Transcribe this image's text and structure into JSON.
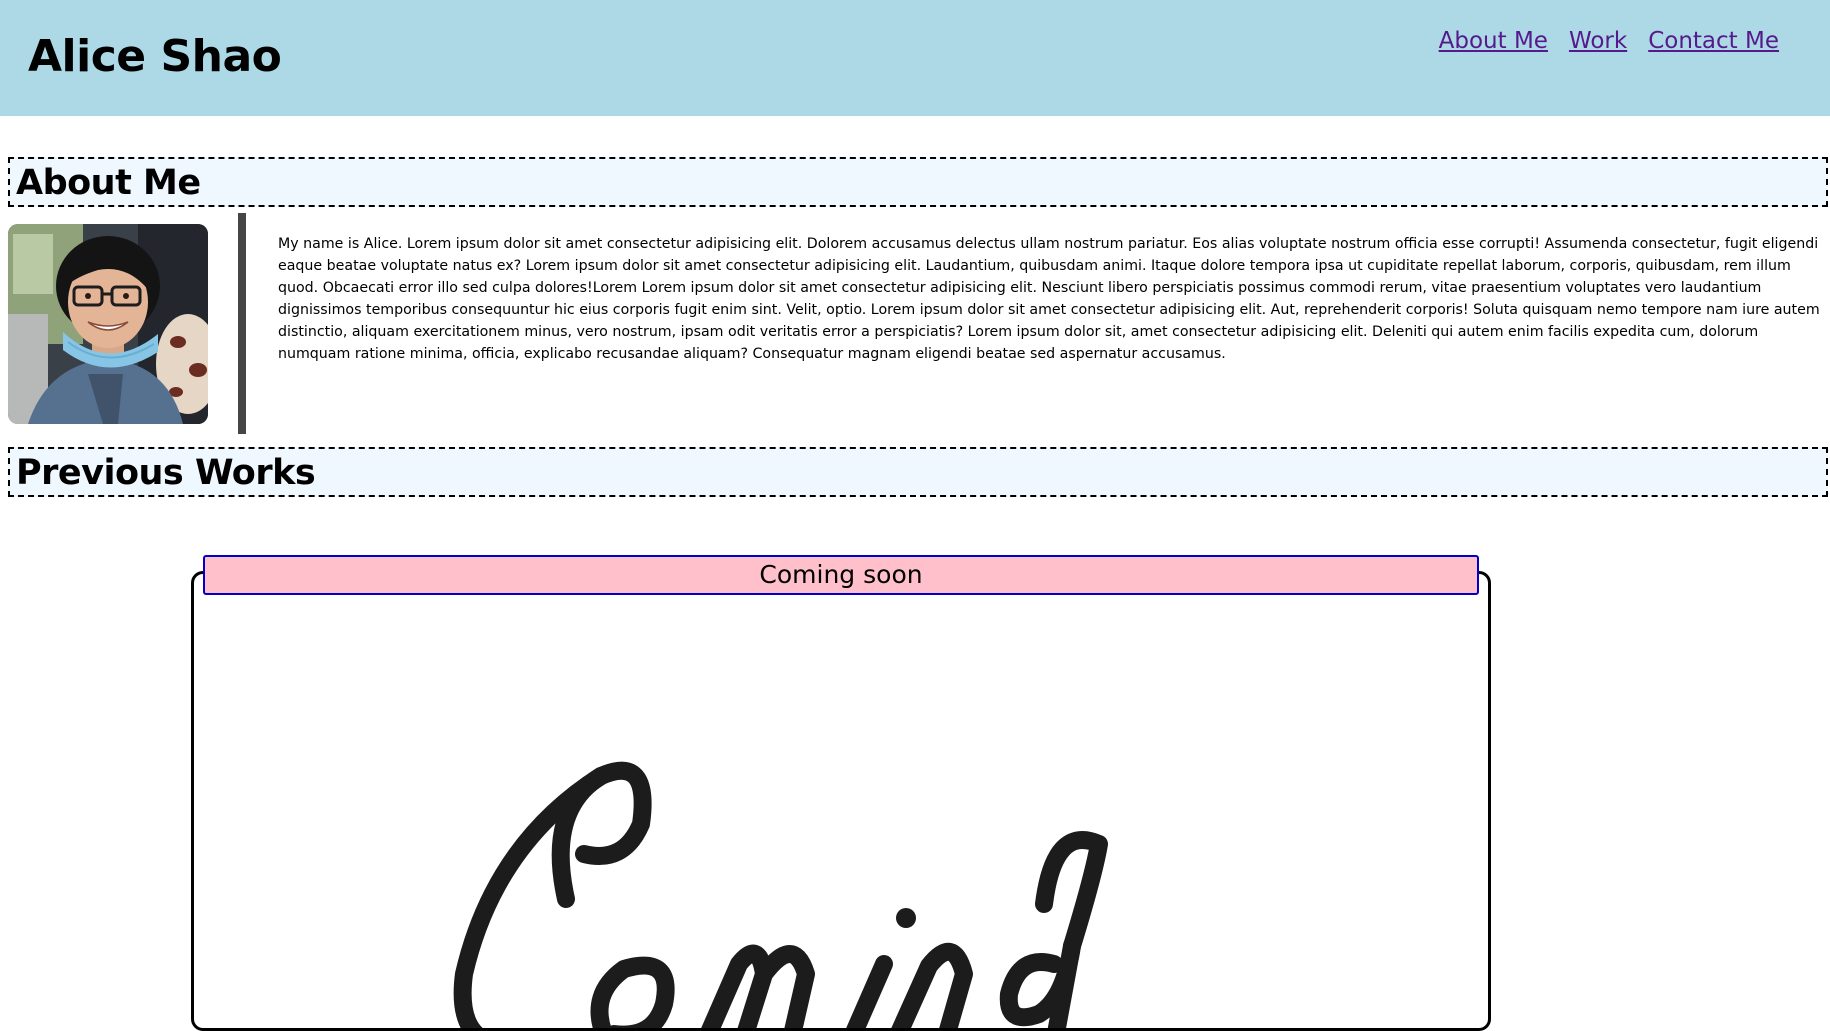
{
  "header": {
    "title": "Alice Shao",
    "nav": [
      {
        "label": "About Me"
      },
      {
        "label": "Work"
      },
      {
        "label": "Contact Me"
      }
    ]
  },
  "about": {
    "heading": "About Me",
    "avatar_icon": "profile-photo",
    "text": "My name is Alice. Lorem ipsum dolor sit amet consectetur adipisicing elit. Dolorem accusamus delectus ullam nostrum pariatur. Eos alias voluptate nostrum officia esse corrupti! Assumenda consectetur, fugit eligendi eaque beatae voluptate natus ex? Lorem ipsum dolor sit amet consectetur adipisicing elit. Laudantium, quibusdam animi. Itaque dolore tempora ipsa ut cupiditate repellat laborum, corporis, quibusdam, rem illum quod. Obcaecati error illo sed culpa dolores!Lorem Lorem ipsum dolor sit amet consectetur adipisicing elit. Nesciunt libero perspiciatis possimus commodi rerum, vitae praesentium voluptates vero laudantium dignissimos temporibus consequuntur hic eius corporis fugit enim sint. Velit, optio. Lorem ipsum dolor sit amet consectetur adipisicing elit. Aut, reprehenderit corporis! Soluta quisquam nemo tempore nam iure autem distinctio, aliquam exercitationem minus, vero nostrum, ipsam odit veritatis error a perspiciatis? Lorem ipsum dolor sit, amet consectetur adipisicing elit. Deleniti qui autem enim facilis expedita cum, dolorum numquam ratione minima, officia, explicabo recusandae aliquam? Consequatur magnam eligendi beatae sed aspernatur accusamus."
  },
  "works": {
    "heading": "Previous Works",
    "card_label": "Coming soon",
    "card_image_icon": "coming-soon-script-image"
  },
  "colors": {
    "header_bg": "#add8e6",
    "heading_bg": "#f0f8ff",
    "card_label_bg": "#ffc0cb",
    "card_label_border": "#0000cd",
    "link": "#551a8b"
  }
}
